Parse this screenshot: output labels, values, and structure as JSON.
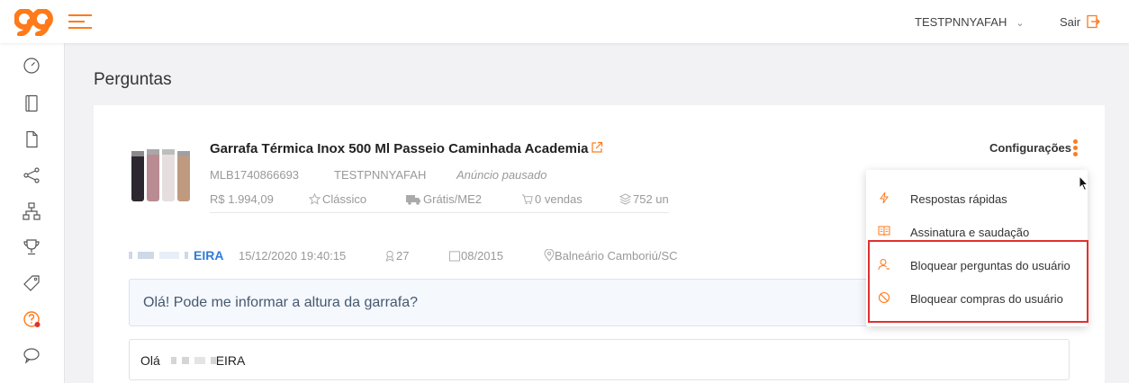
{
  "header": {
    "username": "TESTPNNYAFAH",
    "logout_label": "Sair"
  },
  "page": {
    "title": "Perguntas"
  },
  "product": {
    "title": "Garrafa Térmica Inox 500 Ml Passeio Caminhada Academia",
    "id": "MLB1740866693",
    "seller": "TESTPNNYAFAH",
    "status": "Anúncio pausado",
    "price": "R$ 1.994,09",
    "listing_type": "Clássico",
    "shipping": "Grátis/ME2",
    "sales": "0 vendas",
    "stock": "752 un"
  },
  "config": {
    "label": "Configurações"
  },
  "menu": {
    "items": [
      {
        "label": "Respostas rápidas",
        "icon": "lightning-icon"
      },
      {
        "label": "Assinatura e saudação",
        "icon": "book-icon"
      },
      {
        "label": "Bloquear perguntas do usuário",
        "icon": "user-block-icon"
      },
      {
        "label": "Bloquear compras do usuário",
        "icon": "ban-icon"
      }
    ]
  },
  "asker": {
    "name_suffix": "EIRA",
    "datetime": "15/12/2020 19:40:15",
    "rating": "27",
    "since": "08/2015",
    "location": "Balneário Camboriú/SC"
  },
  "question": {
    "text": "Olá! Pode me informar a altura da garrafa?"
  },
  "answer": {
    "greeting": "Olá",
    "name_suffix": "EIRA"
  },
  "colors": {
    "accent": "#ff7a1a",
    "link": "#2f7bd8",
    "highlight": "#e0302e"
  }
}
